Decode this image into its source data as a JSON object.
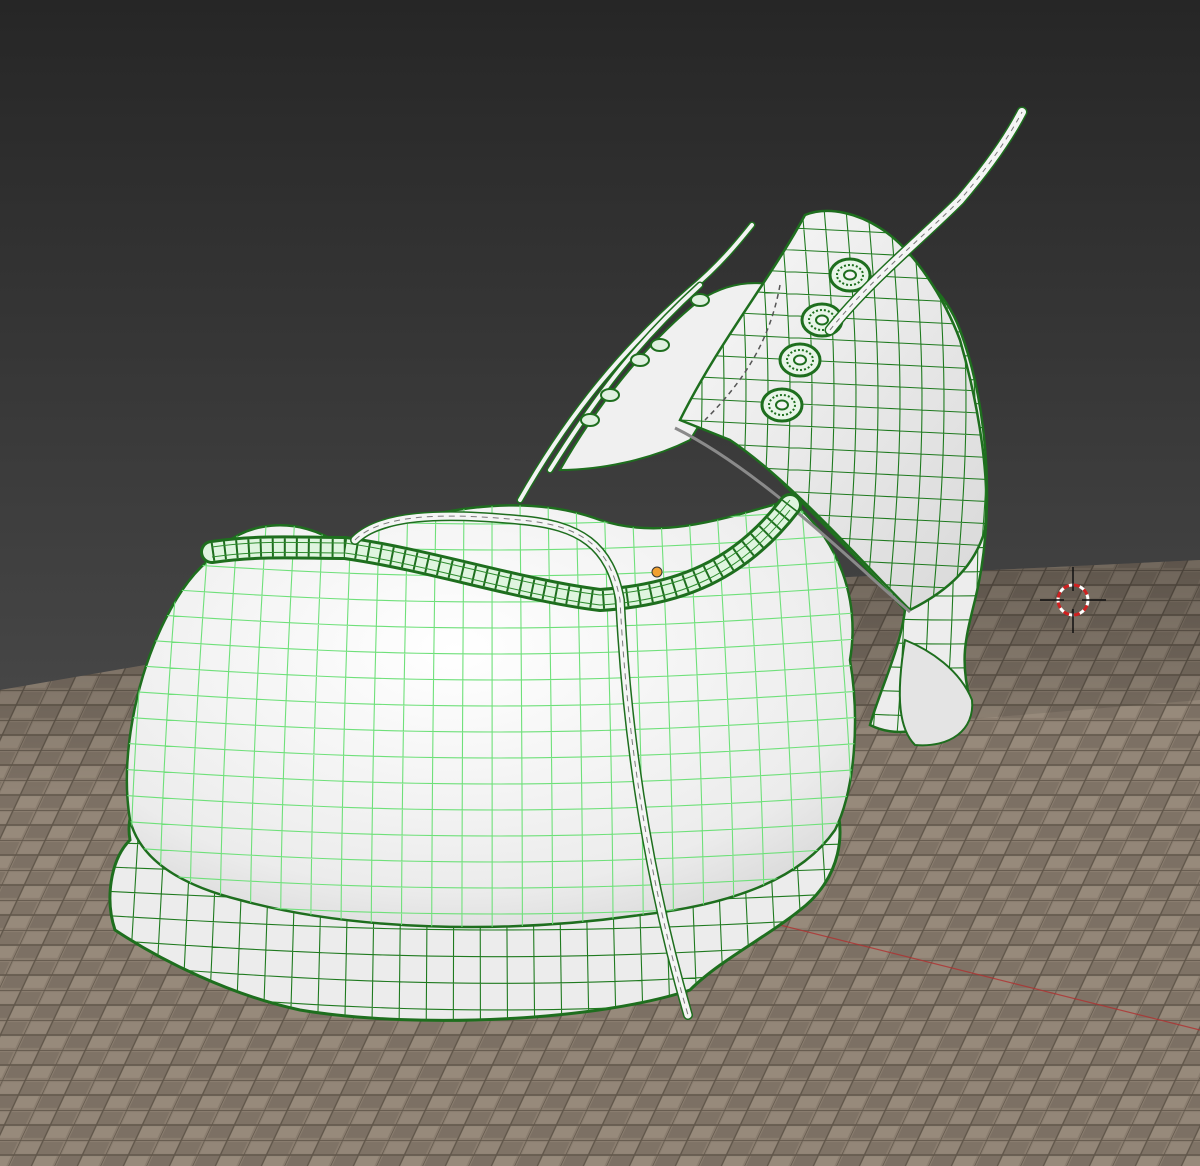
{
  "viewport": {
    "mode": "3d-viewport-solid-wireframe-overlay",
    "object": "shoe-model",
    "colors": {
      "background_top": "#262626",
      "background_bottom": "#5c5c5c",
      "floor": "#8a7d6f",
      "floor_grout": "#5f5549",
      "mesh_surface": "#f2f2f2",
      "wire_light": "#6fe07a",
      "wire_dark": "#1f7a1f",
      "outline": "#1e6e1e",
      "origin": "#f0a030",
      "axis_x": "#b03030",
      "cursor_red": "#d02020",
      "cursor_white": "#ffffff"
    },
    "icons": {
      "cursor": "3d-cursor-icon",
      "origin": "object-origin-icon"
    }
  }
}
